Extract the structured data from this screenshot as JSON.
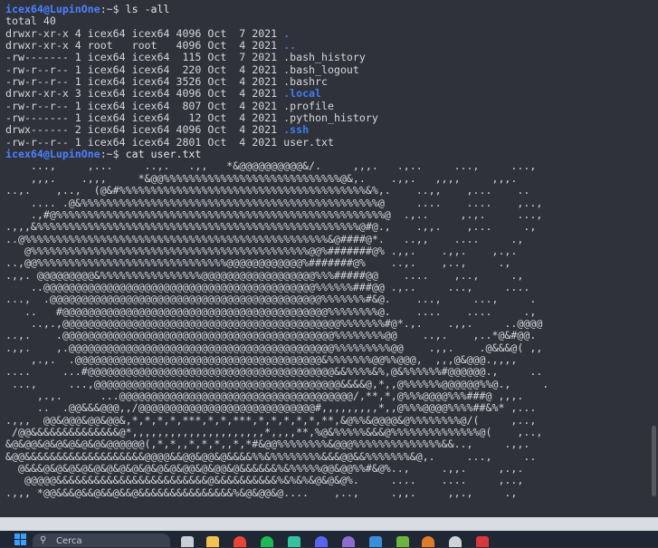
{
  "terminal": {
    "user_host": "icex64@LupinOne",
    "prompt_suffix": ":~$ ",
    "command1": "ls -all",
    "command2": "cat user.txt",
    "total_line": "total 40",
    "listing": [
      {
        "perms": "drwxr-xr-x",
        "links": "4",
        "owner": "icex64",
        "group": "icex64",
        "size": "4096",
        "month": "Oct",
        "day": " 7",
        "year": "2021",
        "name": ".",
        "dir": true
      },
      {
        "perms": "drwxr-xr-x",
        "links": "4",
        "owner": "root  ",
        "group": "root  ",
        "size": "4096",
        "month": "Oct",
        "day": " 4",
        "year": "2021",
        "name": "..",
        "dir": true
      },
      {
        "perms": "-rw-------",
        "links": "1",
        "owner": "icex64",
        "group": "icex64",
        "size": " 115",
        "month": "Oct",
        "day": " 7",
        "year": "2021",
        "name": ".bash_history",
        "dir": false
      },
      {
        "perms": "-rw-r--r--",
        "links": "1",
        "owner": "icex64",
        "group": "icex64",
        "size": " 220",
        "month": "Oct",
        "day": " 4",
        "year": "2021",
        "name": ".bash_logout",
        "dir": false
      },
      {
        "perms": "-rw-r--r--",
        "links": "1",
        "owner": "icex64",
        "group": "icex64",
        "size": "3526",
        "month": "Oct",
        "day": " 4",
        "year": "2021",
        "name": ".bashrc",
        "dir": false
      },
      {
        "perms": "drwxr-xr-x",
        "links": "3",
        "owner": "icex64",
        "group": "icex64",
        "size": "4096",
        "month": "Oct",
        "day": " 4",
        "year": "2021",
        "name": ".local",
        "dir": true
      },
      {
        "perms": "-rw-r--r--",
        "links": "1",
        "owner": "icex64",
        "group": "icex64",
        "size": " 807",
        "month": "Oct",
        "day": " 4",
        "year": "2021",
        "name": ".profile",
        "dir": false
      },
      {
        "perms": "-rw-------",
        "links": "1",
        "owner": "icex64",
        "group": "icex64",
        "size": "  12",
        "month": "Oct",
        "day": " 4",
        "year": "2021",
        "name": ".python_history",
        "dir": false
      },
      {
        "perms": "drwx------",
        "links": "2",
        "owner": "icex64",
        "group": "icex64",
        "size": "4096",
        "month": "Oct",
        "day": " 4",
        "year": "2021",
        "name": ".ssh",
        "dir": true
      },
      {
        "perms": "-rw-r--r--",
        "links": "1",
        "owner": "icex64",
        "group": "icex64",
        "size": "2801",
        "month": "Oct",
        "day": " 4",
        "year": "2021",
        "name": "user.txt",
        "dir": false
      }
    ],
    "art": [
      "    ...,     ,...     ..,.   .,,   *&@@@@@@@@@@&/.     ,,,.   .,..     ...,     ...,",
      "    ,,,.    .,,,     *&@@%%%%%%%%%%%%%%%%%%%%%%%%%%%%@&,.    .,,.   ,,,,     ,,,.",
      "..,.    ,..,  (@&#%%%%%%%%%%%%%%%%%%%%%%%%%%%%%%%%%%%%%%%&%,.    ..,,    ,...    ..",
      "    .... .@&%%%%%%%%%%%%%%%%%%%%%%%%%%%%%%%%%%%%%%%%%%%%%%%@     ....    ....    ,..,",
      "    .,#@%%%%%%%%%%%%%%%%%%%%%%%%%%%%%%%%%%%%%%%%%%%%%%%%%%%%@  .,..     ,.,.     ...,",
      ".,,,&%%%%%%%%%%%%%%%%%%%%%%%%%%%%%%%%%%%%%%%%%%%%%%%%%%%@#@.,    .,,.    ,...     .,",
      "..@%%%%%%%%%%%%%%%%%%%%%%%%%%%%%%%%%%%%%%%%%%%%%%%%&@####@*.   ..,,    ....     .,",
      "   @%%%%%%%%%%%%%%%%%%%%%%%%%%%%%%%%%%%%%%%%%%%%@@%#######@% .,,.    .,,.    ,.,.",
      "..,@@%%%%%%%%%%%%%%%%%%%%%%%%%%%%%%@@@@@@@@@@@@%#######@%    ..,.    ,..,     .,",
      ".,,. @@@@@@@@@&%%%%%%%%%%%%%%%%@@@@@@@@@@@@@@@@@@%%%#####@@    ....    ,..,     .,",
      "    ..@@@@@@@@@@@@@@@@@@@@@@@@@@@@@@@@@@@@@@@@@@@%%%%%%###@@ .,..     ...,     ....",
      "...,  .@@@@@@@@@@@@@@@@@@@@@@@@@@@@@@@@@@@@@@@@@@@%%%%%%%#&@.    ...,     ...,     .",
      "   ..   #@@@@@@@@@@@@@@@@@@@@@@@@@@@@@@@@@@@@@@@@@@%%%%%%%%@.    ....    ....     .,",
      "    ..,.,@@@@@@@@@@@@@@@@@@@@@@@@@@@@@@@@@@@@@@@@@@@@%%%%%%%#@*.,.    .,,.     ..@@@@",
      "..,.    .@@@@@@@@@@@@@@@@@@@@@@@@@@@@@@@@@@@@@@@@@@@%%%%%%%%@@    ..,.    ,..*@&#@@.",
      ".,,.    ,.@@@@@@@@@@@@@@@@@@@@@@@@@@@@@@@@@@@@@@@@@@%%%%%%%%%@@    .,,.    .@&&&@( ,,",
      "    ,.,.  .@@@@@@@@@@@@@@@@@@@@@@@@@@@@@@@@@@@@@@@&%%%%%%%@@%%@@@,  ,,,@&@@@.,,,,",
      "....     ...#@@@@@@@@@@@@@@@@@@@@@@@@@@@@@@@@@@@@@@@&&%%%%&%,@&%%%%%%#@@@@@@.,     ..",
      " ...,     ...,@@@@@@@@@@@@@@@@@@@@@@@@@@@@@@@@@@@@@@@&&&&@,*,,@%%%%%%@@@@@@%%@.,     .",
      "     ,.,.      ...@@@@@@@@@@@@@@@@@@@@@@@@@@@@@@@@@@@@@/,**,*,@%%%@@@@%%%###@ ,,,.",
      "     ..  .@@&&&@@@,,/@@@@@@@@@@@@@@@@@@@@@@@@@@@@#,,,,,,,,,*,,@%%%@@@@%%%%##&%* ,...",
      ".,,,  @@&@@@&@@&@@&,*,*,*,*,***,*,*,***,*,*,*,*,*,**,&@%%&@@@@&@%%%%%%%%@/(     ,..,",
      " /@@&&&&&&&&&&&&&&@*,,,,,,,,,,,,,,,,,,,,,*,,,,**,%@&%%%%%&&&@%%%%%%%%%%%%%%@(    ,..,",
      "&@&@@&@&@&@&@&@&@@@@@@(,*,*,,*,*,*,,*,*#&@@%%%%%%%%&@@@%%%%%%%%%%%%%%&&..,     .,,.",
      "&@@&&&&&&&&&&&&&&&&&&&@@@@&&@@&@@&@&&&&%%&%%%%%%%%&&&@@&&%%%%%%%&@,.     ...,     ..",
      "  @&&&@&@&@&@&@&@&@&@&@&@&@&@@&@&@@&@&&&&&&%&%%%%%@@&@@%%#&@%..,     .,,.     ,.,.",
      "   @@@@@&&&&&&&&&&&&&&&&&&&&&&&&@&&&&&&&&&&%&%&%&@&@&@%.     ....    ....     ,..,",
      ".,,, *@@&&&@&&@&&@&&@&&&&&&&&&&&&&&&%&@&@@&@....    ,..,     .,,.     ,,.,     .,"
    ]
  },
  "taskbar": {
    "search_placeholder": "Cerca",
    "icons": [
      "windows-start-icon",
      "search-icon",
      "task-view-icon",
      "file-explorer-icon",
      "chrome-icon",
      "spotify-icon",
      "store-icon",
      "discord-icon",
      "obs-icon",
      "mail-icon",
      "folder-green-icon",
      "game-icon",
      "chatgpt-icon",
      "red-app-icon"
    ]
  },
  "colors": {
    "terminal_bg": "#2f323b",
    "prompt_user": "#4c82ff",
    "dir_color": "#3f7cf5",
    "text": "#d6d7db",
    "taskbar_bg": "#1f2734"
  }
}
